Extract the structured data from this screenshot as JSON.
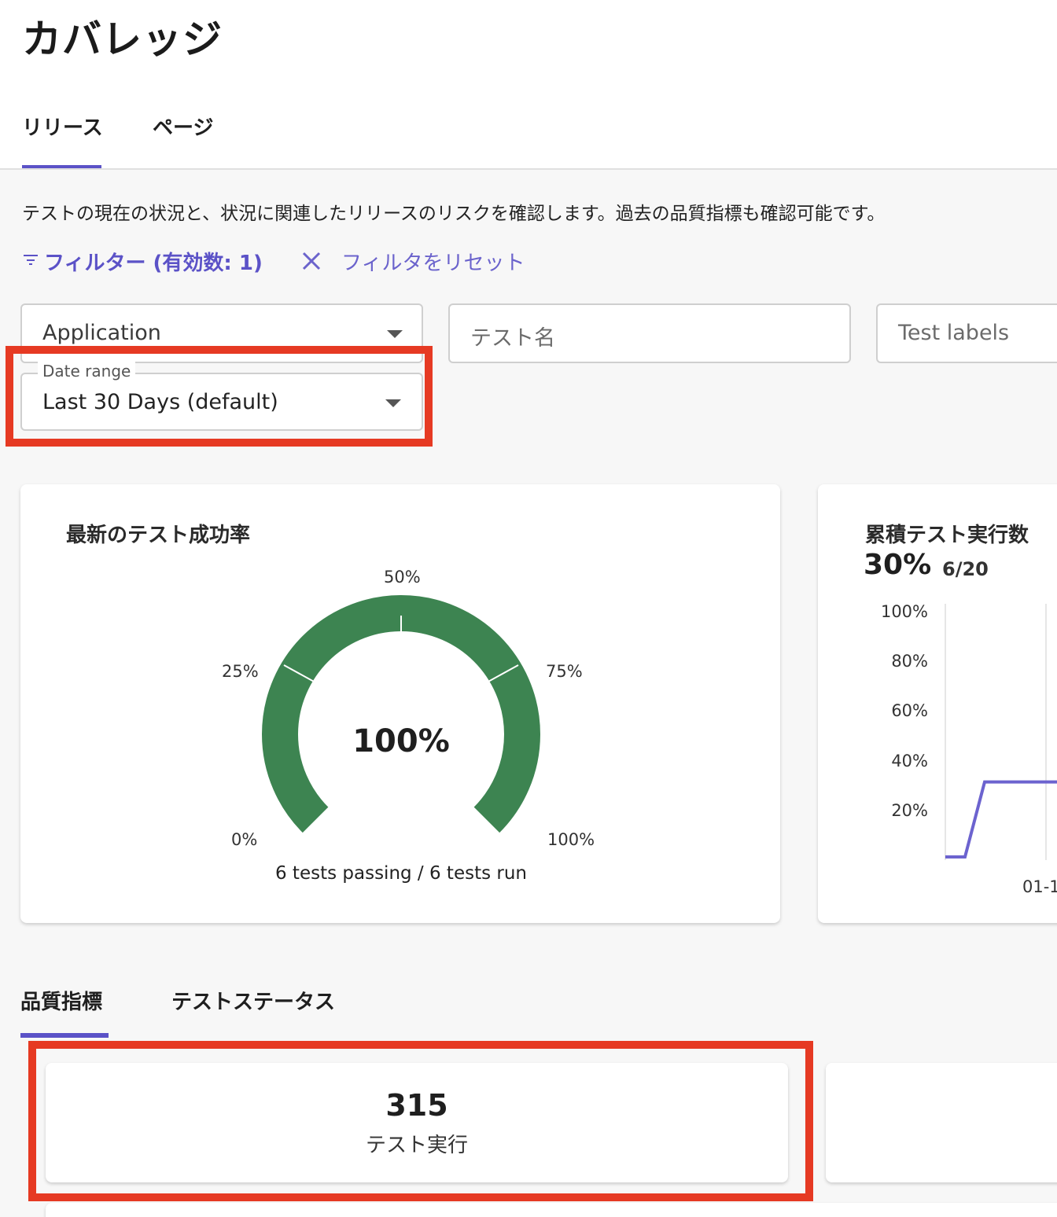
{
  "page": {
    "title": "カバレッジ"
  },
  "top_tabs": [
    {
      "label": "リリース",
      "active": true
    },
    {
      "label": "ページ",
      "active": false
    }
  ],
  "description": "テストの現在の状況と、状況に関連したリリースのリスクを確認します。過去の品質指標も確認可能です。",
  "filters": {
    "toggle_label": "フィルター (有効数: 1)",
    "reset_label": "フィルタをリセット",
    "application_value": "Application",
    "test_name_placeholder": "テスト名",
    "test_labels_placeholder": "Test labels",
    "date_range_label": "Date range",
    "date_range_value": "Last 30 Days (default)"
  },
  "success_card": {
    "title": "最新のテスト成功率",
    "value": "100%",
    "passing_text": "6 tests passing / 6 tests run",
    "gauge_labels": {
      "p0": "0%",
      "p25": "25%",
      "p50": "50%",
      "p75": "75%",
      "p100": "100%"
    },
    "gauge_fraction": 1.0
  },
  "cumulative_card": {
    "title": "累積テスト実行数",
    "percent": "30%",
    "ratio": "6/20",
    "y_ticks": [
      "100%",
      "80%",
      "60%",
      "40%",
      "20%"
    ],
    "x_tick": "01-1"
  },
  "chart_data": {
    "type": "line",
    "title": "累積テスト実行数",
    "ylim": [
      0,
      100
    ],
    "y_ticks": [
      "100%",
      "80%",
      "60%",
      "40%",
      "20%"
    ],
    "x_tick_visible": "01-1",
    "series": [
      {
        "values": [
          0,
          0,
          30,
          30,
          30,
          30,
          30
        ]
      }
    ]
  },
  "bottom_tabs": [
    {
      "label": "品質指標",
      "active": true
    },
    {
      "label": "テストステータス",
      "active": false
    }
  ],
  "metric_card": {
    "value": "315",
    "label": "テスト実行"
  },
  "colors": {
    "accent": "#5b52c7",
    "gauge": "#3d8451",
    "highlight": "#e63a23",
    "line": "#6c63cf"
  }
}
